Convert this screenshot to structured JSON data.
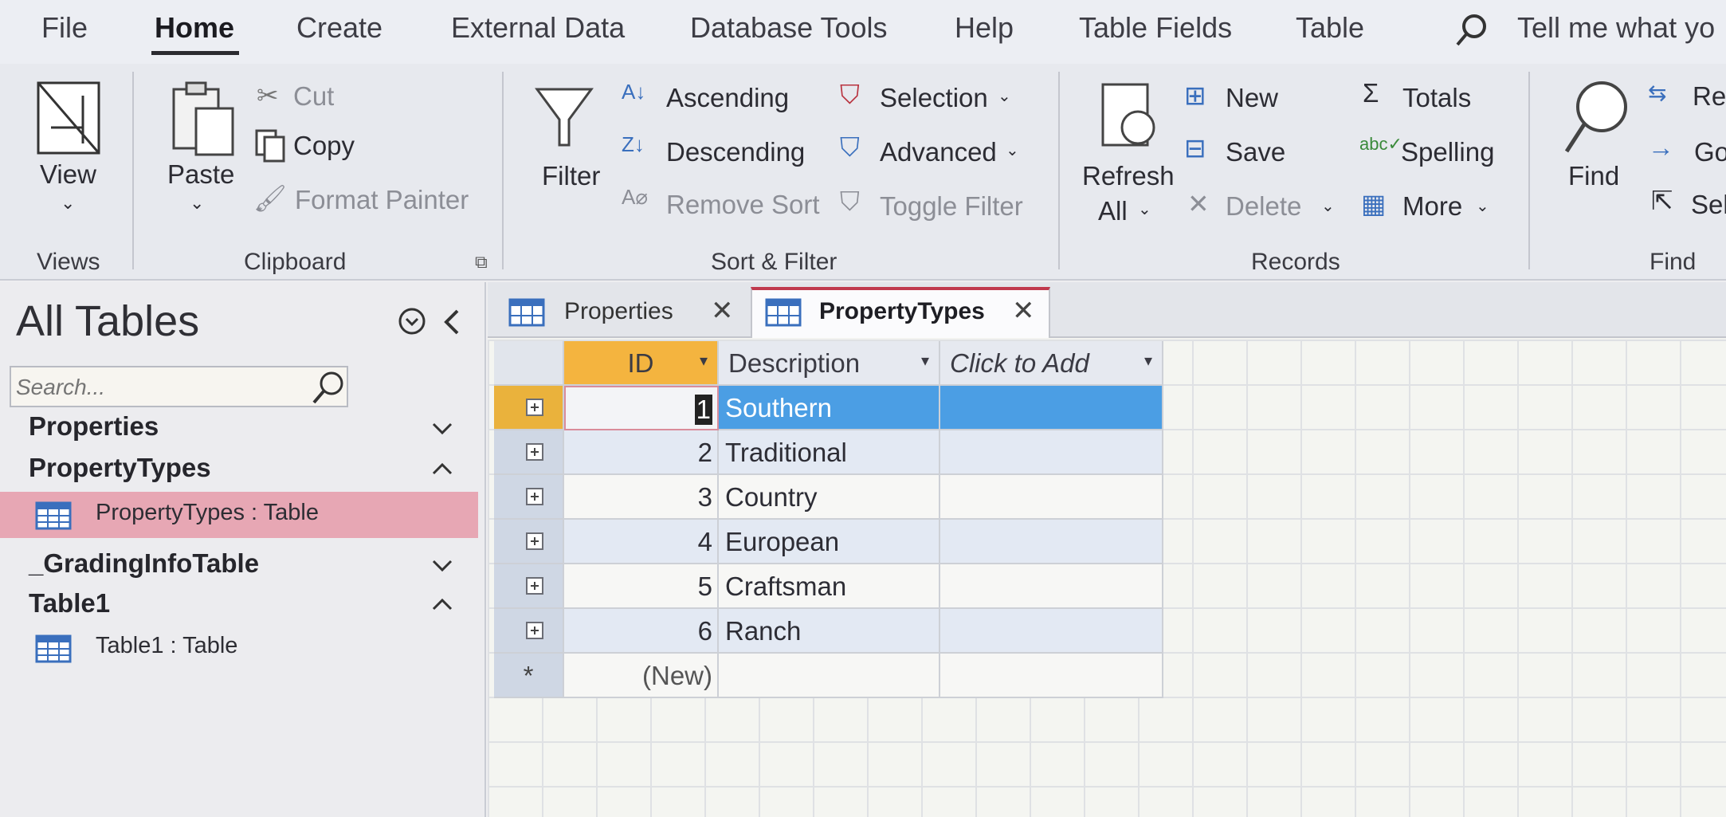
{
  "ribbon_tabs": [
    "File",
    "Home",
    "Create",
    "External Data",
    "Database Tools",
    "Help",
    "Table Fields",
    "Table"
  ],
  "active_tab": "Home",
  "tell_me": "Tell me what yo",
  "views": {
    "view_label": "View",
    "group": "Views"
  },
  "clipboard": {
    "paste": "Paste",
    "cut": "Cut",
    "copy": "Copy",
    "format_painter": "Format Painter",
    "group": "Clipboard"
  },
  "sort_filter": {
    "filter": "Filter",
    "ascending": "Ascending",
    "descending": "Descending",
    "remove_sort": "Remove Sort",
    "selection": "Selection",
    "advanced": "Advanced",
    "toggle_filter": "Toggle Filter",
    "group": "Sort & Filter"
  },
  "records": {
    "refresh": "Refresh",
    "all": "All",
    "new": "New",
    "save": "Save",
    "delete": "Delete",
    "totals": "Totals",
    "spelling": "Spelling",
    "more": "More",
    "group": "Records"
  },
  "find": {
    "find": "Find",
    "replace": "Re",
    "goto": "Go",
    "select": "Sel",
    "group": "Find"
  },
  "nav": {
    "title": "All Tables",
    "search_placeholder": "Search...",
    "groups": [
      {
        "name": "Properties",
        "expanded": false,
        "items": []
      },
      {
        "name": "PropertyTypes",
        "expanded": true,
        "items": [
          "PropertyTypes : Table"
        ]
      },
      {
        "name": "_GradingInfoTable",
        "expanded": false,
        "items": []
      },
      {
        "name": "Table1",
        "expanded": true,
        "items": [
          "Table1 : Table"
        ]
      }
    ]
  },
  "doc_tabs": [
    {
      "label": "Properties",
      "active": false
    },
    {
      "label": "PropertyTypes",
      "active": true
    }
  ],
  "table": {
    "columns": [
      "ID",
      "Description",
      "Click to Add"
    ],
    "rows": [
      {
        "id": "1",
        "description": "Southern"
      },
      {
        "id": "2",
        "description": "Traditional"
      },
      {
        "id": "3",
        "description": "Country"
      },
      {
        "id": "4",
        "description": "European"
      },
      {
        "id": "5",
        "description": "Craftsman"
      },
      {
        "id": "6",
        "description": "Ranch"
      }
    ],
    "new_row_marker": "*",
    "new_row_label": "(New)"
  },
  "colors": {
    "accent_tab": "#c0394d",
    "selected_nav": "#e7a7b4",
    "current_row_selector": "#eab23c",
    "selected_cell": "#4b9ee4"
  }
}
